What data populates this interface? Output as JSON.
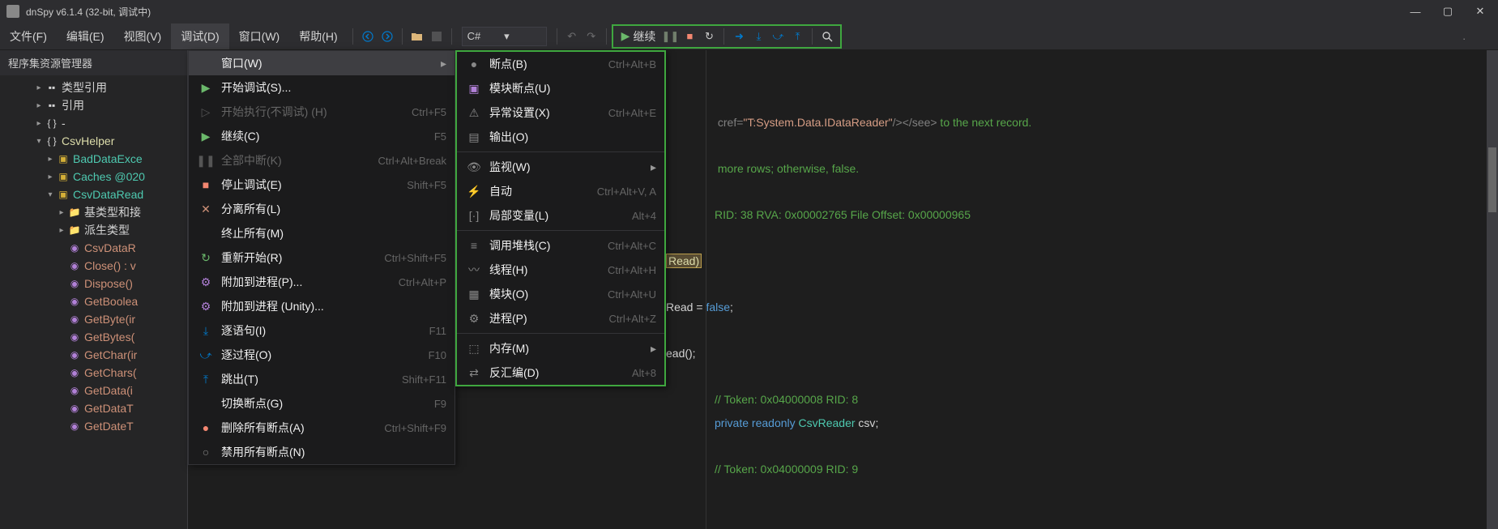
{
  "titlebar": {
    "app_title": "dnSpy v6.1.4 (32-bit, 调试中)"
  },
  "menubar": {
    "file": "文件(F)",
    "edit": "编辑(E)",
    "view": "视图(V)",
    "debug": "调试(D)",
    "window": "窗口(W)",
    "help": "帮助(H)"
  },
  "toolbar": {
    "language": "C#",
    "continue_label": "继续"
  },
  "sidebar": {
    "header": "程序集资源管理器",
    "items": [
      {
        "indent": 3,
        "expander": "▸",
        "icon": "ref",
        "label": "类型引用",
        "color": ""
      },
      {
        "indent": 3,
        "expander": "▸",
        "icon": "ref",
        "label": "引用",
        "color": ""
      },
      {
        "indent": 3,
        "expander": "▸",
        "icon": "ns",
        "label": "-",
        "color": ""
      },
      {
        "indent": 3,
        "expander": "▾",
        "icon": "ns",
        "label": "CsvHelper",
        "color": "lbl-yellow"
      },
      {
        "indent": 4,
        "expander": "▸",
        "icon": "class",
        "label": "BadDataExce",
        "color": "lbl-teal"
      },
      {
        "indent": 4,
        "expander": "▸",
        "icon": "class",
        "label": "Caches @020",
        "color": "lbl-teal"
      },
      {
        "indent": 4,
        "expander": "▾",
        "icon": "class",
        "label": "CsvDataRead",
        "color": "lbl-teal"
      },
      {
        "indent": 5,
        "expander": "▸",
        "icon": "folder",
        "label": "基类型和接",
        "color": ""
      },
      {
        "indent": 5,
        "expander": "▸",
        "icon": "folder",
        "label": "派生类型",
        "color": ""
      },
      {
        "indent": 5,
        "expander": "",
        "icon": "method",
        "label": "CsvDataR",
        "color": "lbl-orange"
      },
      {
        "indent": 5,
        "expander": "",
        "icon": "method",
        "label": "Close() : v",
        "color": "lbl-orange"
      },
      {
        "indent": 5,
        "expander": "",
        "icon": "method",
        "label": "Dispose()",
        "color": "lbl-orange"
      },
      {
        "indent": 5,
        "expander": "",
        "icon": "method",
        "label": "GetBoolea",
        "color": "lbl-orange"
      },
      {
        "indent": 5,
        "expander": "",
        "icon": "method",
        "label": "GetByte(ir",
        "color": "lbl-orange"
      },
      {
        "indent": 5,
        "expander": "",
        "icon": "method",
        "label": "GetBytes(",
        "color": "lbl-orange"
      },
      {
        "indent": 5,
        "expander": "",
        "icon": "method",
        "label": "GetChar(ir",
        "color": "lbl-orange"
      },
      {
        "indent": 5,
        "expander": "",
        "icon": "method",
        "label": "GetChars(",
        "color": "lbl-orange"
      },
      {
        "indent": 5,
        "expander": "",
        "icon": "method",
        "label": "GetData(i",
        "color": "lbl-orange"
      },
      {
        "indent": 5,
        "expander": "",
        "icon": "method",
        "label": "GetDataT",
        "color": "lbl-orange"
      },
      {
        "indent": 5,
        "expander": "",
        "icon": "method",
        "label": "GetDateT",
        "color": "lbl-orange"
      }
    ]
  },
  "debug_menu": {
    "items": [
      {
        "icon": "",
        "label": "窗口(W)",
        "shortcut": "",
        "arrow": true,
        "highlighted": true
      },
      {
        "icon": "play",
        "label": "开始调试(S)...",
        "shortcut": "",
        "disabled": false
      },
      {
        "icon": "play-o",
        "label": "开始执行(不调试) (H)",
        "shortcut": "Ctrl+F5",
        "disabled": true
      },
      {
        "icon": "play",
        "label": "继续(C)",
        "shortcut": "F5"
      },
      {
        "icon": "pause",
        "label": "全部中断(K)",
        "shortcut": "Ctrl+Alt+Break",
        "disabled": true
      },
      {
        "icon": "stop",
        "label": "停止调试(E)",
        "shortcut": "Shift+F5"
      },
      {
        "icon": "detach",
        "label": "分离所有(L)",
        "shortcut": ""
      },
      {
        "icon": "",
        "label": "终止所有(M)",
        "shortcut": ""
      },
      {
        "icon": "restart",
        "label": "重新开始(R)",
        "shortcut": "Ctrl+Shift+F5"
      },
      {
        "icon": "attach",
        "label": "附加到进程(P)...",
        "shortcut": "Ctrl+Alt+P"
      },
      {
        "icon": "attach",
        "label": "附加到进程 (Unity)...",
        "shortcut": ""
      },
      {
        "icon": "step-in",
        "label": "逐语句(I)",
        "shortcut": "F11"
      },
      {
        "icon": "step-over",
        "label": "逐过程(O)",
        "shortcut": "F10"
      },
      {
        "icon": "step-out",
        "label": "跳出(T)",
        "shortcut": "Shift+F11"
      },
      {
        "icon": "",
        "label": "切换断点(G)",
        "shortcut": "F9"
      },
      {
        "icon": "bp-del",
        "label": "删除所有断点(A)",
        "shortcut": "Ctrl+Shift+F9"
      },
      {
        "icon": "bp-dis",
        "label": "禁用所有断点(N)",
        "shortcut": ""
      }
    ]
  },
  "window_submenu": {
    "items": [
      {
        "icon": "bp",
        "label": "断点(B)",
        "shortcut": "Ctrl+Alt+B"
      },
      {
        "icon": "mbp",
        "label": "模块断点(U)",
        "shortcut": ""
      },
      {
        "icon": "exc",
        "label": "异常设置(X)",
        "shortcut": "Ctrl+Alt+E"
      },
      {
        "icon": "out",
        "label": "输出(O)",
        "shortcut": ""
      },
      {
        "sep": true
      },
      {
        "icon": "watch",
        "label": "监视(W)",
        "shortcut": "",
        "arrow": true
      },
      {
        "icon": "auto",
        "label": "自动",
        "shortcut": "Ctrl+Alt+V, A"
      },
      {
        "icon": "local",
        "label": "局部变量(L)",
        "shortcut": "Alt+4"
      },
      {
        "sep": true
      },
      {
        "icon": "stack",
        "label": "调用堆栈(C)",
        "shortcut": "Ctrl+Alt+C"
      },
      {
        "icon": "thread",
        "label": "线程(H)",
        "shortcut": "Ctrl+Alt+H"
      },
      {
        "icon": "mod",
        "label": "模块(O)",
        "shortcut": "Ctrl+Alt+U"
      },
      {
        "icon": "proc",
        "label": "进程(P)",
        "shortcut": "Ctrl+Alt+Z"
      },
      {
        "sep": true
      },
      {
        "icon": "mem",
        "label": "内存(M)",
        "shortcut": "",
        "arrow": true
      },
      {
        "icon": "dis",
        "label": "反汇编(D)",
        "shortcut": "Alt+8"
      }
    ]
  },
  "code": {
    "line1_pre": " cref=",
    "line1_str": "\"T:System.Data.IDataReader\"",
    "line1_mid": "/></see>",
    "line1_post": " to the next record.",
    "line2": " more rows; otherwise, false.",
    "line3": "RID: 38 RVA: 0x00002765 File Offset: 0x00000965",
    "line4": "Read)",
    "line5_a": "Read",
    "line5_b": " = ",
    "line5_c": "false",
    "line5_d": ";",
    "line6": "ead();",
    "line7": "// Token: 0x04000008 RID: 8",
    "line8_a": "private",
    "line8_b": " readonly",
    "line8_c": " CsvReader",
    "line8_d": " csv",
    "line8_e": ";",
    "line9": "// Token: 0x04000009 RID: 9"
  }
}
